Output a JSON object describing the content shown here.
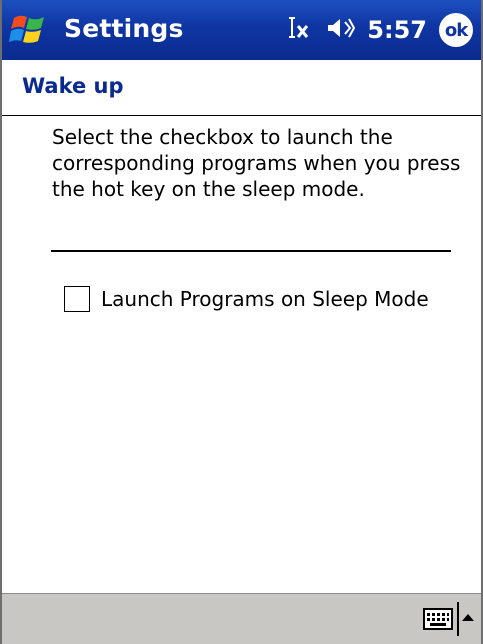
{
  "titlebar": {
    "app_title": "Settings",
    "clock": "5:57",
    "ok_label": "ok",
    "icons": [
      "windows-start-icon",
      "input-mode-icon",
      "volume-icon",
      "ok-icon"
    ]
  },
  "page": {
    "title": "Wake up",
    "description": "Select the checkbox to launch the corresponding programs when you press the hot key on the sleep mode.",
    "option_label": "Launch Programs on Sleep Mode",
    "option_checked": false
  },
  "menubar": {
    "icons": [
      "keyboard-icon",
      "sip-arrow-up-icon"
    ]
  },
  "colors": {
    "titlebar": "#0f35a3",
    "header_text": "#0a2a8f",
    "menubar": "#c9c7c4"
  }
}
